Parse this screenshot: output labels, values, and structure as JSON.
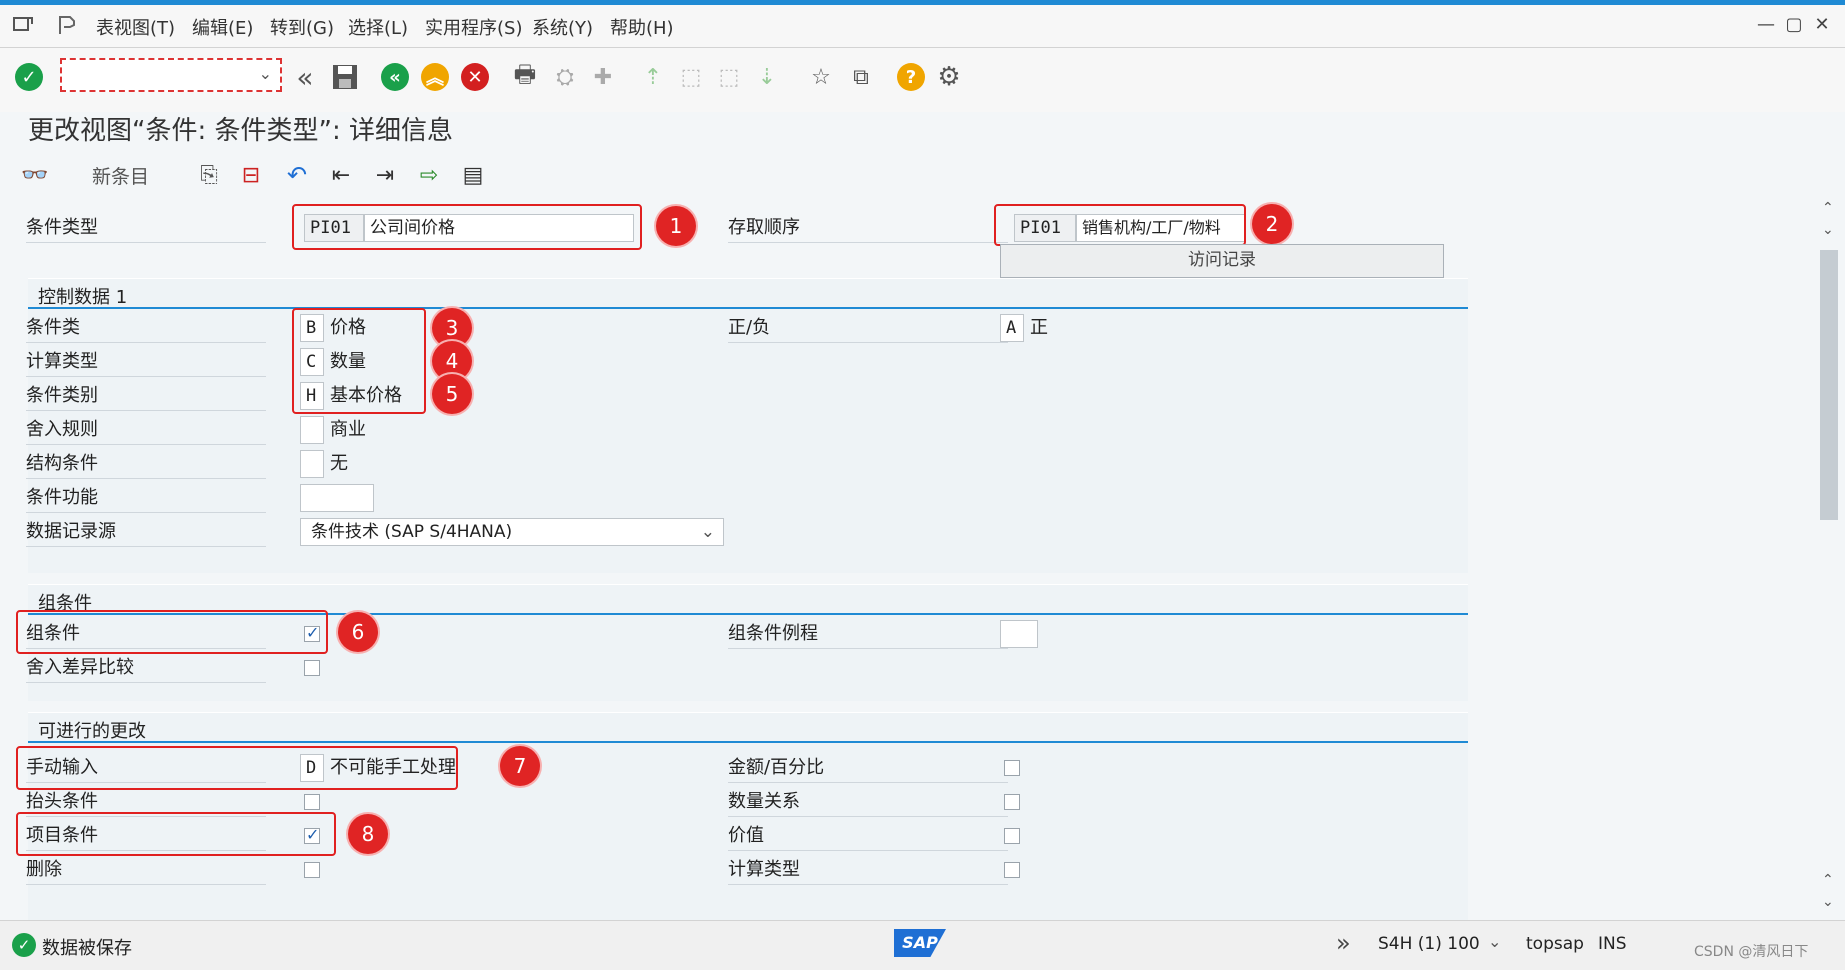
{
  "menu": [
    "表视图(T)",
    "编辑(E)",
    "转到(G)",
    "选择(L)",
    "实用程序(S)",
    "系统(Y)",
    "帮助(H)"
  ],
  "page_title": "更改视图“条件: 条件类型”: 详细信息",
  "app_toolbar": {
    "new_entries": "新条目"
  },
  "header": {
    "cond_type_label": "条件类型",
    "cond_type_code": "PI01",
    "cond_type_desc": "公司间价格",
    "access_seq_label": "存取顺序",
    "access_seq_code": "PI01",
    "access_seq_desc": "销售机构/工厂/物料",
    "access_records_btn": "访问记录"
  },
  "control1": {
    "title": "控制数据 1",
    "cond_class_label": "条件类",
    "cond_class_code": "B",
    "cond_class_desc": "价格",
    "calc_type_label": "计算类型",
    "calc_type_code": "C",
    "calc_type_desc": "数量",
    "cond_category_label": "条件类别",
    "cond_category_code": "H",
    "cond_category_desc": "基本价格",
    "rounding_label": "舍入规则",
    "rounding_desc": "商业",
    "struct_label": "结构条件",
    "struct_desc": "无",
    "function_label": "条件功能",
    "source_label": "数据记录源",
    "source_value": "条件技术 (SAP S/4HANA)",
    "plusminus_label": "正/负",
    "plusminus_code": "A",
    "plusminus_desc": "正"
  },
  "group": {
    "title": "组条件",
    "group_cond_label": "组条件",
    "group_cond_checked": true,
    "round_diff_label": "舍入差异比较",
    "round_diff_checked": false,
    "group_routine_label": "组条件例程"
  },
  "changes": {
    "title": "可进行的更改",
    "manual_label": "手动输入",
    "manual_code": "D",
    "manual_desc": "不可能手工处理",
    "header_label": "抬头条件",
    "header_checked": false,
    "item_label": "项目条件",
    "item_checked": true,
    "delete_label": "删除",
    "delete_checked": false,
    "amount_label": "金额/百分比",
    "qty_rel_label": "数量关系",
    "value_label": "价值",
    "calc_label": "计算类型"
  },
  "markers": [
    "1",
    "2",
    "3",
    "4",
    "5",
    "6",
    "7",
    "8"
  ],
  "status": {
    "message": "数据被保存",
    "system": "S4H (1) 100",
    "host": "topsap",
    "mode": "INS",
    "watermark": "CSDN @清风日下"
  },
  "colors": {
    "accent": "#1f8ad4",
    "highlight": "#e02020",
    "ok": "#1aa04a"
  }
}
